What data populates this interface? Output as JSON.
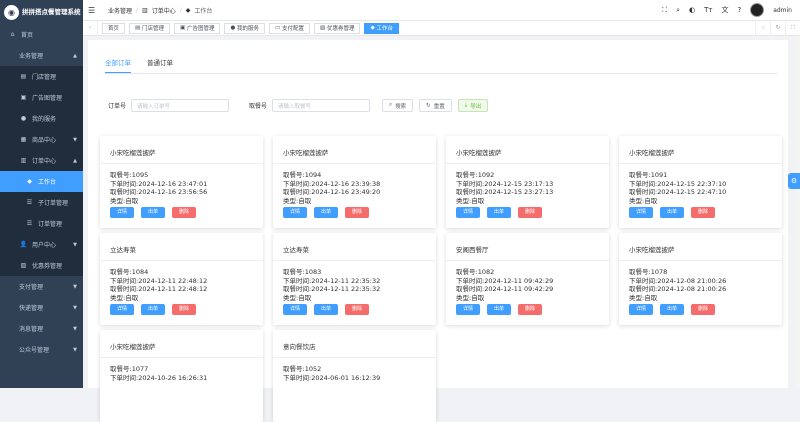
{
  "brand": {
    "title": "拼拼搭点餐管理系统"
  },
  "sidebar": {
    "home": "首页",
    "groups": [
      {
        "label": "业务管理",
        "children": [
          "门店管理",
          "广告图管理",
          "我的服务",
          "商品中心",
          "订单中心"
        ]
      },
      {
        "order_children": [
          "工作台",
          "子订单管理",
          "订单管理"
        ]
      },
      {
        "after": [
          "用户中心",
          "优惠券管理"
        ]
      },
      {
        "sections": [
          "支付管理",
          "快递管理",
          "消息管理",
          "公众号管理"
        ]
      }
    ]
  },
  "navbar": {
    "breadcrumb": [
      "业务管理",
      "订单中心",
      "工作台"
    ],
    "username": "admin"
  },
  "tags": [
    "首页",
    "门店管理",
    "广告图管理",
    "我的服务",
    "支付配置",
    "优惠券管理",
    "工作台"
  ],
  "tabs": [
    "全部订单",
    "普通订单"
  ],
  "filters": {
    "order_no_label": "订单号",
    "order_no_placeholder": "请输入订单号",
    "pickup_label": "取餐号",
    "pickup_placeholder": "请输入取餐号",
    "search": "搜索",
    "reset": "重置",
    "export": "导出"
  },
  "card_buttons": {
    "detail": "详情",
    "out": "出单",
    "delete": "删除"
  },
  "orders": [
    {
      "shop": "小宋吃榴莲披萨",
      "pickup": "取餐号:1095",
      "order_time": "下单时间:2024-12-16 23:47:01",
      "pick_time": "取餐时间:2024-12-16 23:56:56",
      "type": "类型:自取"
    },
    {
      "shop": "小宋吃榴莲披萨",
      "pickup": "取餐号:1094",
      "order_time": "下单时间:2024-12-16 23:39:38",
      "pick_time": "取餐时间:2024-12-16 23:49:20",
      "type": "类型:自取"
    },
    {
      "shop": "小宋吃榴莲披萨",
      "pickup": "取餐号:1092",
      "order_time": "下单时间:2024-12-15 23:17:13",
      "pick_time": "取餐时间:2024-12-15 23:27:13",
      "type": "类型:自取"
    },
    {
      "shop": "小宋吃榴莲披萨",
      "pickup": "取餐号:1091",
      "order_time": "下单时间:2024-12-15 22:37:10",
      "pick_time": "取餐时间:2024-12-15 22:47:10",
      "type": "类型:自取"
    },
    {
      "shop": "立达寿菜",
      "pickup": "取餐号:1084",
      "order_time": "下单时间:2024-12-11 22:48:12",
      "pick_time": "取餐时间:2024-12-11 22:48:12",
      "type": "类型:自取"
    },
    {
      "shop": "立达寿菜",
      "pickup": "取餐号:1083",
      "order_time": "下单时间:2024-12-11 22:35:32",
      "pick_time": "取餐时间:2024-12-11 22:35:32",
      "type": "类型:自取"
    },
    {
      "shop": "安阁西餐厅",
      "pickup": "取餐号:1082",
      "order_time": "下单时间:2024-12-11 09:42:29",
      "pick_time": "取餐时间:2024-12-11 09:42:29",
      "type": "类型:自取"
    },
    {
      "shop": "小宋吃榴莲披萨",
      "pickup": "取餐号:1078",
      "order_time": "下单时间:2024-12-08 21:00:26",
      "pick_time": "取餐时间:2024-12-08 21:00:26",
      "type": "类型:自取"
    },
    {
      "shop": "小宋吃榴莲披萨",
      "pickup": "取餐号:1077",
      "order_time": "下单时间:2024-10-26 16:26:31",
      "pick_time": "",
      "type": ""
    },
    {
      "shop": "意向餐饮店",
      "pickup": "取餐号:1052",
      "order_time": "下单时间:2024-06-01 16:12:39",
      "pick_time": "",
      "type": ""
    }
  ]
}
